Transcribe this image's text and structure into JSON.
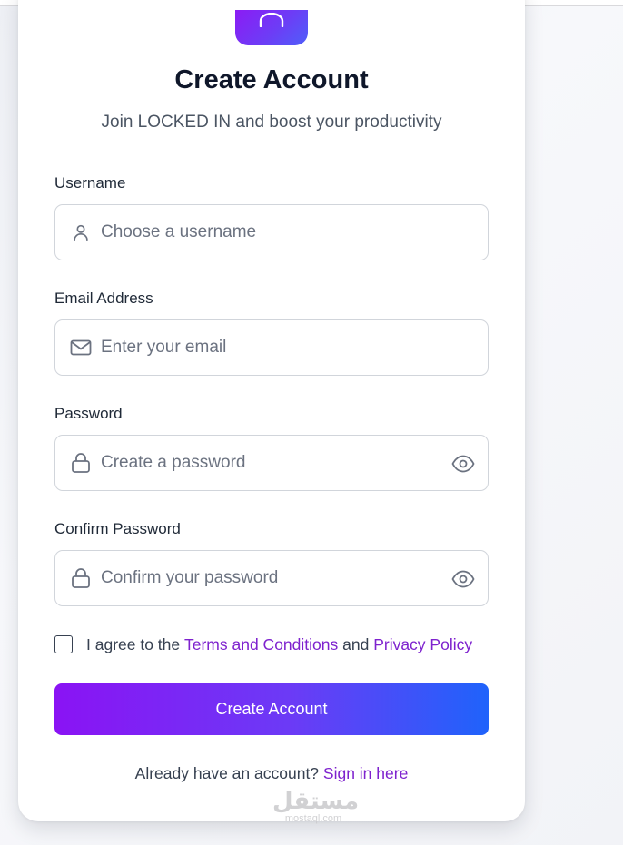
{
  "header": {
    "title": "Create Account",
    "subtitle": "Join LOCKED IN and boost your productivity"
  },
  "form": {
    "username": {
      "label": "Username",
      "placeholder": "Choose a username",
      "icon": "user-icon"
    },
    "email": {
      "label": "Email Address",
      "placeholder": "Enter your email",
      "icon": "mail-icon"
    },
    "password": {
      "label": "Password",
      "placeholder": "Create a password",
      "icon": "lock-icon",
      "toggle_icon": "eye-icon"
    },
    "confirm_password": {
      "label": "Confirm Password",
      "placeholder": "Confirm your password",
      "icon": "lock-icon",
      "toggle_icon": "eye-icon"
    },
    "agreement": {
      "prefix": "I agree to the ",
      "terms_link": "Terms and Conditions",
      "conjunction": " and ",
      "privacy_link": "Privacy Policy",
      "checked": false
    },
    "submit_label": "Create Account"
  },
  "footer": {
    "prompt": "Already have an account? ",
    "signin_link": "Sign in here"
  },
  "watermark": {
    "logo": "مستقل",
    "sub": "mostaql.com"
  },
  "colors": {
    "accent_purple": "#7e22ce",
    "button_gradient_start": "#8a13f4",
    "button_gradient_end": "#1f63fb",
    "title": "#0f172a"
  }
}
